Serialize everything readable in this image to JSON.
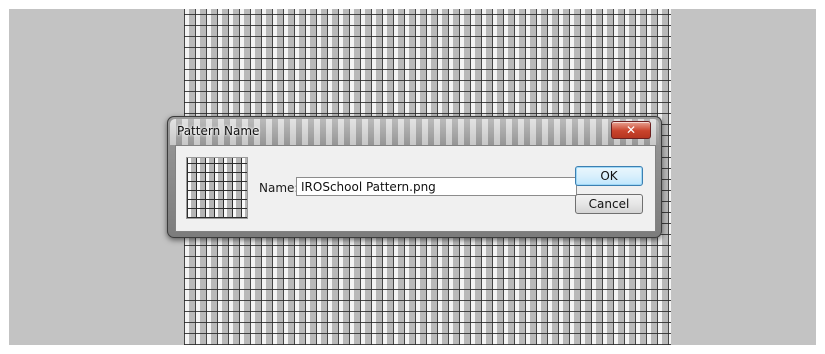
{
  "dialog": {
    "title": "Pattern Name",
    "close_label": "✕",
    "name_label": "Name:",
    "name_value": "IROSchool Pattern.png",
    "ok_label": "OK",
    "cancel_label": "Cancel"
  },
  "icons": {
    "close": "close-icon",
    "thumbnail": "pattern-thumbnail"
  },
  "colors": {
    "close_button": "#c9432c",
    "default_button_border": "#3c7fb1",
    "canvas_background": "#c3c3c3"
  }
}
